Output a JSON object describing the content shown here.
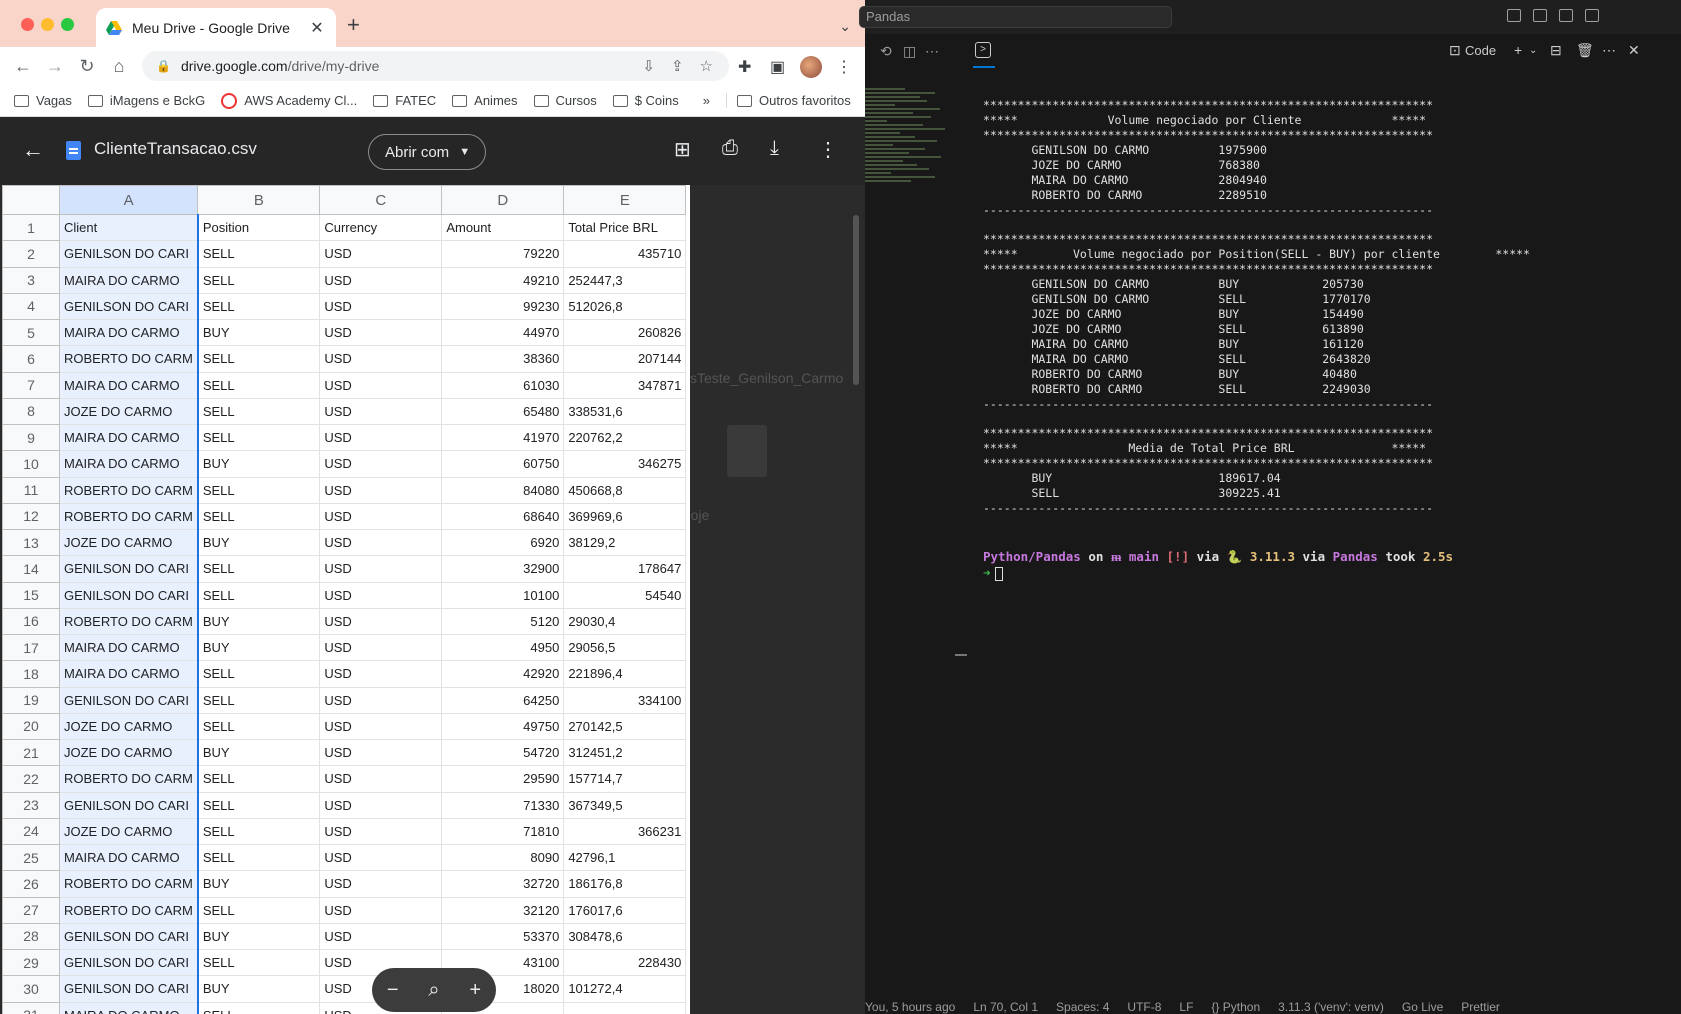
{
  "browser": {
    "tab_title": "Meu Drive - Google Drive",
    "url_host": "drive.google.com",
    "url_path": "/drive/my-drive",
    "bookmarks": [
      "Vagas",
      "iMagens e BckG",
      "AWS Academy Cl...",
      "FATEC",
      "Animes",
      "Cursos",
      "$ Coins"
    ],
    "more_bookmarks": "»",
    "other_favorites": "Outros favoritos"
  },
  "viewer": {
    "filename": "ClienteTransacao.csv",
    "open_with": "Abrir com",
    "ghost_filename": "sTeste_Genilson_Carmo",
    "ghost_caption": "s hoje"
  },
  "sheet": {
    "col_letters": [
      "A",
      "B",
      "C",
      "D",
      "E"
    ],
    "headers": [
      "Client",
      "Position",
      "Currency",
      "Amount",
      "Total Price BRL"
    ],
    "rows": [
      [
        "GENILSON DO CARI",
        "SELL",
        "USD",
        "79220",
        "435710",
        true
      ],
      [
        "MAIRA DO CARMO",
        "SELL",
        "USD",
        "49210",
        "252447,3",
        false
      ],
      [
        "GENILSON DO CARI",
        "SELL",
        "USD",
        "99230",
        "512026,8",
        false
      ],
      [
        "MAIRA DO CARMO",
        "BUY",
        "USD",
        "44970",
        "260826",
        true
      ],
      [
        "ROBERTO DO CARM",
        "SELL",
        "USD",
        "38360",
        "207144",
        true
      ],
      [
        "MAIRA DO CARMO",
        "SELL",
        "USD",
        "61030",
        "347871",
        true
      ],
      [
        "JOZE DO CARMO",
        "SELL",
        "USD",
        "65480",
        "338531,6",
        false
      ],
      [
        "MAIRA DO CARMO",
        "SELL",
        "USD",
        "41970",
        "220762,2",
        false
      ],
      [
        "MAIRA DO CARMO",
        "BUY",
        "USD",
        "60750",
        "346275",
        true
      ],
      [
        "ROBERTO DO CARM",
        "SELL",
        "USD",
        "84080",
        "450668,8",
        false
      ],
      [
        "ROBERTO DO CARM",
        "SELL",
        "USD",
        "68640",
        "369969,6",
        false
      ],
      [
        "JOZE DO CARMO",
        "BUY",
        "USD",
        "6920",
        "38129,2",
        false
      ],
      [
        "GENILSON DO CARI",
        "SELL",
        "USD",
        "32900",
        "178647",
        true
      ],
      [
        "GENILSON DO CARI",
        "SELL",
        "USD",
        "10100",
        "54540",
        true
      ],
      [
        "ROBERTO DO CARM",
        "BUY",
        "USD",
        "5120",
        "29030,4",
        false
      ],
      [
        "MAIRA DO CARMO",
        "BUY",
        "USD",
        "4950",
        "29056,5",
        false
      ],
      [
        "MAIRA DO CARMO",
        "SELL",
        "USD",
        "42920",
        "221896,4",
        false
      ],
      [
        "GENILSON DO CARI",
        "SELL",
        "USD",
        "64250",
        "334100",
        true
      ],
      [
        "JOZE DO CARMO",
        "SELL",
        "USD",
        "49750",
        "270142,5",
        false
      ],
      [
        "JOZE DO CARMO",
        "BUY",
        "USD",
        "54720",
        "312451,2",
        false
      ],
      [
        "ROBERTO DO CARM",
        "SELL",
        "USD",
        "29590",
        "157714,7",
        false
      ],
      [
        "GENILSON DO CARI",
        "SELL",
        "USD",
        "71330",
        "367349,5",
        false
      ],
      [
        "JOZE DO CARMO",
        "SELL",
        "USD",
        "71810",
        "366231",
        true
      ],
      [
        "MAIRA DO CARMO",
        "SELL",
        "USD",
        "8090",
        "42796,1",
        false
      ],
      [
        "ROBERTO DO CARM",
        "BUY",
        "USD",
        "32720",
        "186176,8",
        false
      ],
      [
        "ROBERTO DO CARM",
        "SELL",
        "USD",
        "32120",
        "176017,6",
        false
      ],
      [
        "GENILSON DO CARI",
        "BUY",
        "USD",
        "53370",
        "308478,6",
        false
      ],
      [
        "GENILSON DO CARI",
        "SELL",
        "USD",
        "43100",
        "228430",
        true
      ],
      [
        "GENILSON DO CARI",
        "BUY",
        "USD",
        "18020",
        "101272,4",
        false
      ],
      [
        "MAIRA DO CARMO",
        "SELL",
        "USD",
        "",
        "",
        false
      ]
    ]
  },
  "vscode": {
    "command_center": "Pandas",
    "panel_label": "Code",
    "terminal_lines": [
      "*****************************************************************",
      "*****             Volume negociado por Cliente             *****",
      "*****************************************************************",
      "       GENILSON DO CARMO          1975900",
      "       JOZE DO CARMO              768380",
      "       MAIRA DO CARMO             2804940",
      "       ROBERTO DO CARMO           2289510",
      "-----------------------------------------------------------------",
      "",
      "*****************************************************************",
      "*****        Volume negociado por Position(SELL - BUY) por cliente        *****",
      "*****************************************************************",
      "       GENILSON DO CARMO          BUY            205730",
      "       GENILSON DO CARMO          SELL           1770170",
      "       JOZE DO CARMO              BUY            154490",
      "       JOZE DO CARMO              SELL           613890",
      "       MAIRA DO CARMO             BUY            161120",
      "       MAIRA DO CARMO             SELL           2643820",
      "       ROBERTO DO CARMO           BUY            40480",
      "       ROBERTO DO CARMO           SELL           2249030",
      "-----------------------------------------------------------------",
      "",
      "*****************************************************************",
      "*****                Media de Total Price BRL              *****",
      "*****************************************************************",
      "       BUY                        189617.04",
      "       SELL                       309225.41",
      "-----------------------------------------------------------------"
    ],
    "prompt": {
      "dir": "Python/Pandas",
      "on": " on ",
      "branch": "ᵯ main",
      "status": " [!]",
      "via": " via ",
      "pyver": "🐍 3.11.3",
      "via2": " via ",
      "env": "Pandas",
      "took": " took ",
      "time": "2.5s"
    },
    "prompt_arrow": "➜",
    "status_bar": [
      "You, 5 hours ago",
      "Ln 70, Col 1",
      "Spaces: 4",
      "UTF-8",
      "LF",
      "{} Python",
      "3.11.3 ('venv': venv)",
      "Go Live",
      "Prettier"
    ]
  }
}
